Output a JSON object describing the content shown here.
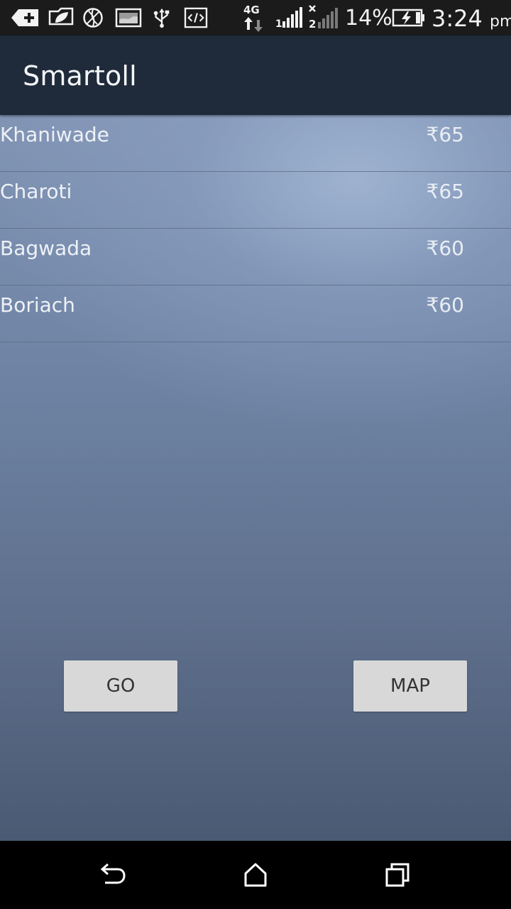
{
  "status_bar": {
    "network_type": "4G",
    "sim1_label": "1",
    "sim2_label": "2",
    "battery_percent": "14%",
    "time": "3:24",
    "time_suffix": "pm",
    "icons": [
      "add-notification-icon",
      "leaf-icon",
      "basketball-icon",
      "image-icon",
      "usb-icon",
      "code-icon",
      "data-arrows-icon",
      "signal-sim1-icon",
      "signal-sim2-icon",
      "battery-charging-icon"
    ]
  },
  "app_bar": {
    "title": "Smartoll"
  },
  "toll_list": [
    {
      "name": "Khaniwade",
      "fee": "₹65"
    },
    {
      "name": "Charoti",
      "fee": "₹65"
    },
    {
      "name": "Bagwada",
      "fee": "₹60"
    },
    {
      "name": "Boriach",
      "fee": "₹60"
    }
  ],
  "buttons": {
    "go_label": "GO",
    "map_label": "MAP"
  },
  "nav_bar": {
    "icons": [
      "back-icon",
      "home-icon",
      "recents-icon"
    ]
  },
  "colors": {
    "status_bar": "#1b1b1b",
    "app_bar": "#1f2b3a",
    "button_bg": "#d8d8d8",
    "content_top": "#8194b4",
    "content_bottom": "#4a5a73"
  }
}
